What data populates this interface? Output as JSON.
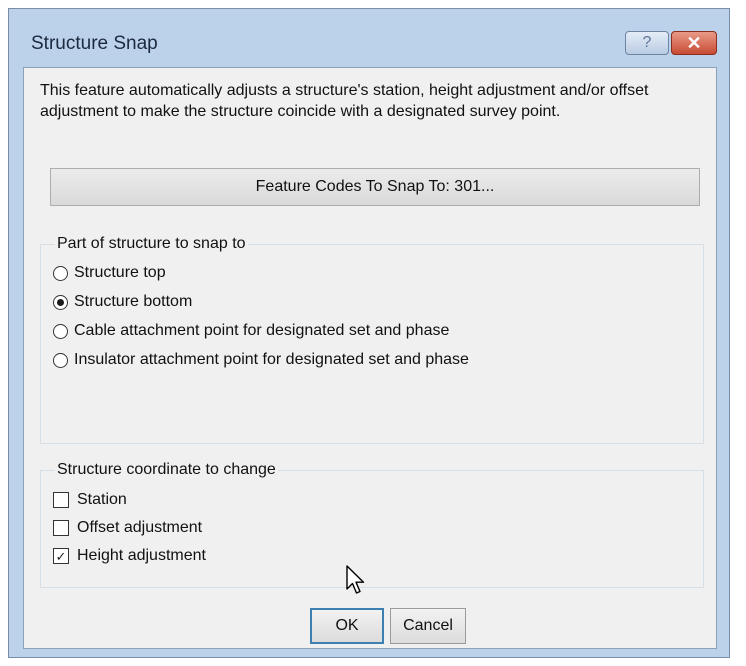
{
  "window": {
    "title": "Structure Snap",
    "help_glyph": "?",
    "close_glyph": "✕"
  },
  "description": "This feature automatically adjusts a structure's  station, height adjustment and/or offset adjustment to make the structure coincide with a designated survey point.",
  "feature_codes_button": "Feature Codes To Snap To: 301...",
  "part_group": {
    "legend": "Part of structure to snap to",
    "options": [
      {
        "label": "Structure top",
        "selected": false
      },
      {
        "label": "Structure bottom",
        "selected": true
      },
      {
        "label": "Cable attachment point for designated set and phase",
        "selected": false
      },
      {
        "label": "Insulator attachment point for designated set and phase",
        "selected": false
      }
    ]
  },
  "coord_group": {
    "legend": "Structure coordinate to change",
    "options": [
      {
        "label": "Station",
        "checked": false
      },
      {
        "label": "Offset adjustment",
        "checked": false
      },
      {
        "label": "Height adjustment",
        "checked": true
      }
    ]
  },
  "buttons": {
    "ok": "OK",
    "cancel": "Cancel"
  },
  "check_glyph": "✓",
  "colors": {
    "frame": "#bcd1ea",
    "close_button": "#c84b33",
    "dialog_background": "#f0f0f0",
    "default_button_border": "#3c7fb1"
  },
  "icons": {
    "help": "question-mark-icon",
    "close": "close-icon",
    "cursor": "mouse-pointer-icon"
  }
}
